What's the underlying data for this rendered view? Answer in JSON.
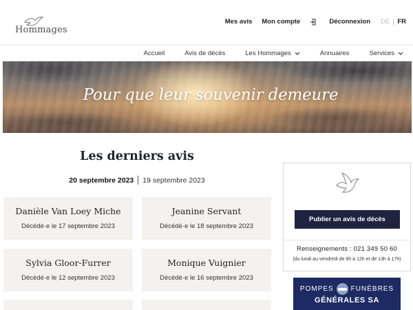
{
  "header": {
    "logo_text": "Hommages",
    "links": [
      "Mes avis",
      "Mon compte"
    ],
    "logout_label": "Déconnexion",
    "lang": {
      "de": "DE",
      "fr": "FR",
      "active": "FR"
    }
  },
  "nav": {
    "items": [
      {
        "label": "Accueil",
        "dropdown": false
      },
      {
        "label": "Avis de décès",
        "dropdown": false
      },
      {
        "label": "Les Hommages",
        "dropdown": true
      },
      {
        "label": "Annuaires",
        "dropdown": false
      },
      {
        "label": "Services",
        "dropdown": true
      }
    ]
  },
  "hero": {
    "tagline": "Pour que leur souvenir demeure"
  },
  "main": {
    "title": "Les derniers avis",
    "dates": {
      "active": "20 septembre 2023",
      "other": "19 septembre 2023"
    },
    "cards": [
      {
        "name": "Danièle Van Loey Miche",
        "deceased": "Décédé·e le 17 septembre 2023"
      },
      {
        "name": "Jeanine Servant",
        "deceased": "Décédé·e le 18 septembre 2023"
      },
      {
        "name": "Sylvia Gloor-Furrer",
        "deceased": "Décédé·e le 12 septembre 2023"
      },
      {
        "name": "Monique Vuignier",
        "deceased": "Décédé·e le 16 septembre 2023"
      }
    ]
  },
  "sidebar": {
    "publish_label": "Publier un avis de décès",
    "phone": "Renseignements : 021 349 50 60",
    "hours": "(du lundi au vendredi de 8h à 12h et de 13h à 17h)",
    "ad": {
      "line1_left": "POMPES",
      "line1_right": "FUNÈBRES",
      "line2": "GÉNÉRALES SA"
    }
  },
  "colors": {
    "primary_dark": "#1f2340",
    "card_bg": "#f4f2ee",
    "ad_bg": "#1d2a63"
  }
}
